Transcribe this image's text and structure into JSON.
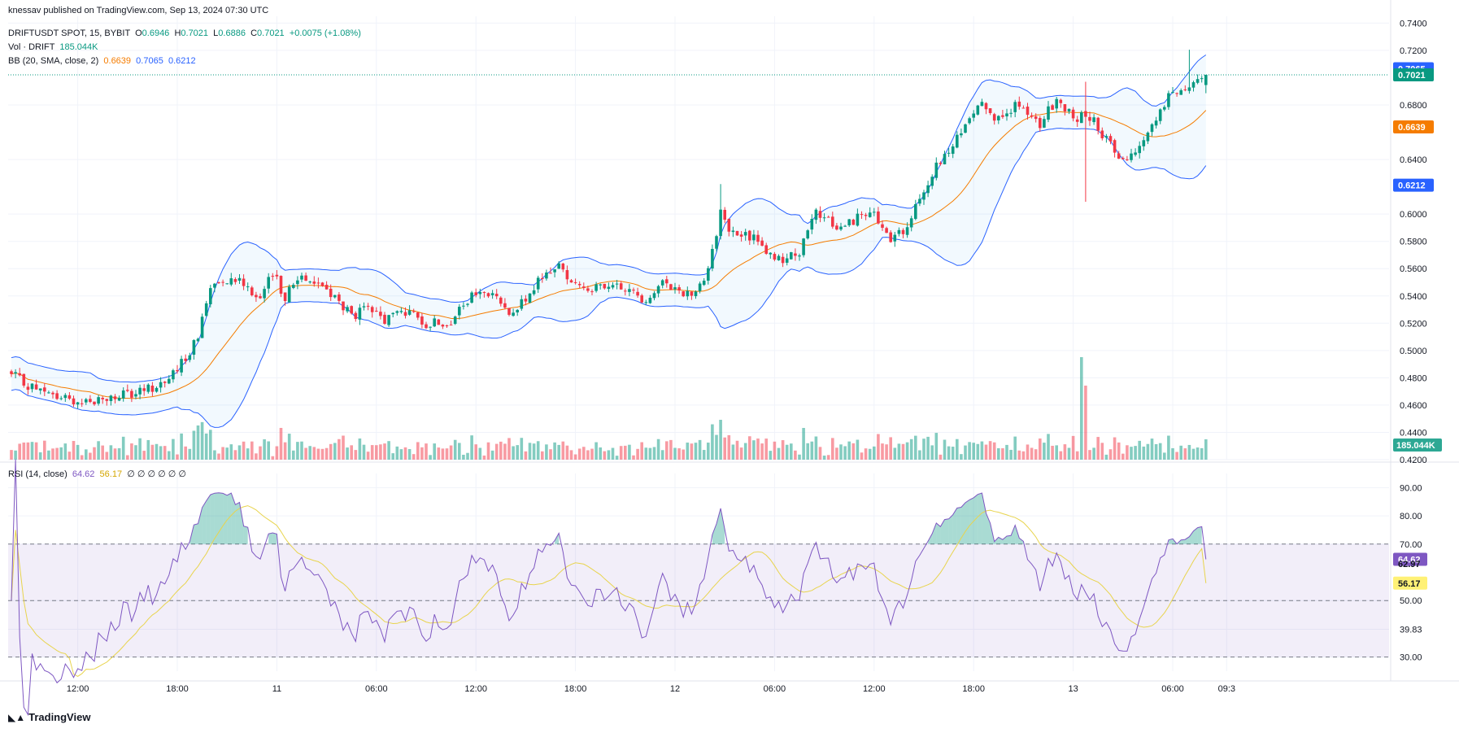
{
  "publisher": "knessav published on TradingView.com, Sep 13, 2024 07:30 UTC",
  "symbol": "DRIFTUSDT SPOT, 15, BYBIT",
  "ohlc": {
    "o_label": "O",
    "o": "0.6946",
    "h_label": "H",
    "h": "0.7021",
    "l_label": "L",
    "l": "0.6886",
    "c_label": "C",
    "c": "0.7021",
    "chg": "+0.0075 (+1.08%)"
  },
  "volume_legend": {
    "label": "Vol · DRIFT",
    "value": "185.044K"
  },
  "bb_legend": {
    "label": "BB (20, SMA, close, 2)",
    "basis": "0.6639",
    "upper": "0.7065",
    "lower": "0.6212"
  },
  "rsi_legend": {
    "label": "RSI (14, close)",
    "rsi": "64.62",
    "ma": "56.17",
    "extras": "∅ ∅ ∅ ∅ ∅ ∅"
  },
  "logo_text": "TradingView",
  "colors": {
    "up": "#089981",
    "down": "#f23645",
    "bb_basis": "#f57c00",
    "bb_band": "#2962ff",
    "rsi": "#7e57c2",
    "rsi_ma": "#e8d44d"
  },
  "chart_data": {
    "type": "candlestick",
    "timeframe": "15",
    "price_axis": {
      "ticks": [
        "0.7400",
        "0.7200",
        "0.6800",
        "0.6400",
        "0.6000",
        "0.5800",
        "0.5600",
        "0.5400",
        "0.5200",
        "0.5000",
        "0.4800",
        "0.4600",
        "0.4400",
        "0.4200"
      ],
      "range": [
        0.42,
        0.745
      ]
    },
    "price_labels": [
      {
        "value": 0.7065,
        "text": "0.7065",
        "color": "#2962ff"
      },
      {
        "value": 0.7021,
        "text": "0.7021",
        "color": "#089981"
      },
      {
        "value": 0.6639,
        "text": "0.6639",
        "color": "#f57c00"
      },
      {
        "value": 0.6212,
        "text": "0.6212",
        "color": "#2962ff"
      }
    ],
    "volume_label": "185.044K",
    "rsi_axis": {
      "ticks": [
        "90.00",
        "80.00",
        "70.00",
        "50.00",
        "39.83",
        "30.00"
      ],
      "range": [
        25,
        95
      ]
    },
    "rsi_labels": [
      {
        "value": 64.62,
        "text": "64.62",
        "color": "#7e57c2",
        "dark": false
      },
      {
        "value": 62.97,
        "text": "62.97",
        "color": "",
        "dark": false
      },
      {
        "value": 56.17,
        "text": "56.17",
        "color": "#fff176",
        "dark": true
      }
    ],
    "time_axis": [
      {
        "text": "12:00",
        "i": 16
      },
      {
        "text": "18:00",
        "i": 40
      },
      {
        "text": "11",
        "i": 64
      },
      {
        "text": "06:00",
        "i": 88
      },
      {
        "text": "12:00",
        "i": 112
      },
      {
        "text": "18:00",
        "i": 136
      },
      {
        "text": "12",
        "i": 160
      },
      {
        "text": "06:00",
        "i": 184
      },
      {
        "text": "12:00",
        "i": 208
      },
      {
        "text": "18:00",
        "i": 232
      },
      {
        "text": "13",
        "i": 256
      },
      {
        "text": "06:00",
        "i": 280
      },
      {
        "text": "09:3",
        "i": 293
      }
    ],
    "anchors": [
      [
        0,
        0.482
      ],
      [
        8,
        0.468
      ],
      [
        14,
        0.464
      ],
      [
        20,
        0.463
      ],
      [
        25,
        0.466
      ],
      [
        30,
        0.468
      ],
      [
        36,
        0.476
      ],
      [
        40,
        0.485
      ],
      [
        45,
        0.51
      ],
      [
        48,
        0.548
      ],
      [
        50,
        0.553
      ],
      [
        55,
        0.553
      ],
      [
        60,
        0.538
      ],
      [
        63,
        0.556
      ],
      [
        66,
        0.54
      ],
      [
        70,
        0.556
      ],
      [
        76,
        0.545
      ],
      [
        82,
        0.525
      ],
      [
        86,
        0.53
      ],
      [
        90,
        0.522
      ],
      [
        94,
        0.53
      ],
      [
        100,
        0.52
      ],
      [
        106,
        0.522
      ],
      [
        112,
        0.542
      ],
      [
        116,
        0.54
      ],
      [
        120,
        0.53
      ],
      [
        124,
        0.535
      ],
      [
        128,
        0.555
      ],
      [
        132,
        0.562
      ],
      [
        136,
        0.548
      ],
      [
        142,
        0.545
      ],
      [
        148,
        0.546
      ],
      [
        152,
        0.537
      ],
      [
        158,
        0.55
      ],
      [
        164,
        0.54
      ],
      [
        168,
        0.56
      ],
      [
        171,
        0.6
      ],
      [
        174,
        0.585
      ],
      [
        180,
        0.582
      ],
      [
        184,
        0.565
      ],
      [
        190,
        0.572
      ],
      [
        194,
        0.6
      ],
      [
        200,
        0.59
      ],
      [
        204,
        0.598
      ],
      [
        208,
        0.598
      ],
      [
        212,
        0.58
      ],
      [
        216,
        0.59
      ],
      [
        222,
        0.63
      ],
      [
        226,
        0.645
      ],
      [
        230,
        0.665
      ],
      [
        234,
        0.685
      ],
      [
        238,
        0.668
      ],
      [
        242,
        0.68
      ],
      [
        248,
        0.665
      ],
      [
        252,
        0.685
      ],
      [
        256,
        0.67
      ],
      [
        260,
        0.672
      ],
      [
        264,
        0.655
      ],
      [
        268,
        0.64
      ],
      [
        272,
        0.65
      ],
      [
        276,
        0.67
      ],
      [
        280,
        0.69
      ],
      [
        284,
        0.695
      ],
      [
        288,
        0.702
      ]
    ],
    "bars": 289,
    "special_candles": [
      {
        "i": 171,
        "high": 0.622,
        "note": "spike"
      },
      {
        "i": 259,
        "low": 0.609,
        "high": 0.697,
        "note": "wick"
      },
      {
        "i": 284,
        "high": 0.7205,
        "note": "spike"
      }
    ],
    "volume_spikes": [
      {
        "i": 258,
        "mult": 9.0
      },
      {
        "i": 259,
        "mult": 6.5
      },
      {
        "i": 171,
        "mult": 3.5
      },
      {
        "i": 45,
        "mult": 3.0
      }
    ],
    "bb": {
      "period": 20,
      "mult": 2
    },
    "rsi": {
      "period": 14,
      "ma_period": 14,
      "upper": 70,
      "middle": 50,
      "lower": 30
    }
  }
}
